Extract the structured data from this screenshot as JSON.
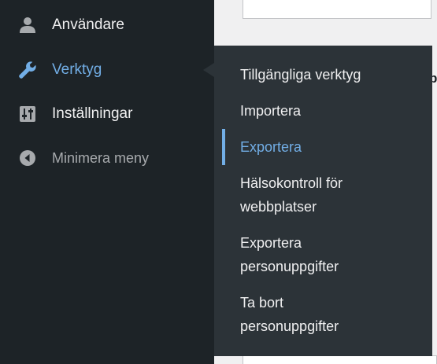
{
  "menu": {
    "users_label": "Användare",
    "tools_label": "Verktyg",
    "settings_label": "Inställningar",
    "collapse_label": "Minimera meny"
  },
  "submenu": {
    "items": [
      "Tillgängliga verktyg",
      "Importera",
      "Exportera",
      "Hälsokontroll för webbplatser",
      "Exportera personuppgifter",
      "Ta bort personuppgifter"
    ],
    "current": "Exportera"
  },
  "colors": {
    "menu_bg": "#1d2327",
    "submenu_bg": "#2c3338",
    "accent": "#72aee6",
    "text": "#f0f0f1",
    "muted": "#a7aaad"
  },
  "icons": {
    "users": "user-icon",
    "tools": "wrench-icon",
    "settings": "sliders-icon",
    "collapse": "collapse-arrow-icon"
  }
}
